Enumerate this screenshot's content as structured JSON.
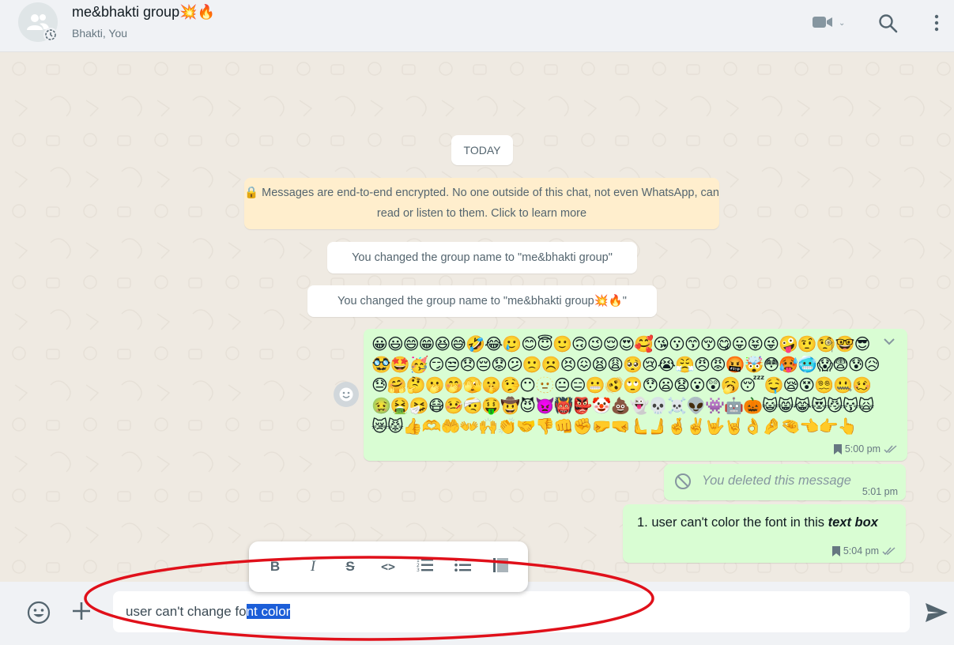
{
  "header": {
    "title": "me&bhakti group💥🔥",
    "subtitle": "Bhakti, You",
    "icons": [
      "group-avatar-icon",
      "video-call-icon",
      "chevron-down-icon",
      "search-icon",
      "menu-icon"
    ]
  },
  "chat": {
    "date_label": "TODAY",
    "encryption_notice": "🔒 Messages are end-to-end encrypted. No one outside of this chat, not even WhatsApp, can read or listen to them. Click to learn more",
    "system_messages": [
      "You changed the group name to \"me&bhakti group\"",
      "You changed the group name to \"me&bhakti group💥🔥\""
    ],
    "messages": [
      {
        "type": "emoji",
        "text": "😀😃😄😁😆😅🤣😂🥲😊😇🙂🙃😉😌😍🥰😘😗😙😚😋😛😝😜🤪🤨🧐🤓😎🥸🤩🥳😏😒😞😔😟😕🙁☹️😣😖😫😩🥺😢😭😤😠😡🤬🤯😳🥵🥶😱😨😰😥😓🤗🤔🫢🤭🫣🤫🤥😶🫥😐😑😬🫨🙄😯😦😧😮😲🥱😴🤤😪😵😵‍💫🤐🥴🤢🤮🤧😷🤒🤕🤑🤠😈👿👹👺🤡💩👻💀☠️👽👾🤖🎃😺😸😹😻😼😽🙀😿😾👍🫶🤲👐🙌👏🤝👎👊✊🤛🤜🫷🫸🤞✌️🤟🤘👌🤌🤏👈👉👆",
        "time": "5:00 pm"
      },
      {
        "type": "deleted",
        "text": "You deleted this message",
        "time": "5:01 pm"
      },
      {
        "type": "text",
        "list_number": "1.",
        "text_plain": "user can't color the font in this ",
        "text_bold": "text box",
        "time": "5:04 pm"
      }
    ]
  },
  "format_toolbar": {
    "bold": "B",
    "italic": "I",
    "strike": "S",
    "code": "<>",
    "ordered_list": "ordered-list-icon",
    "bullet_list": "bullet-list-icon",
    "quote": "quote-icon"
  },
  "composer": {
    "text_before_selection": "user can't change fo",
    "selected_text": "nt color",
    "icons": [
      "emoji-icon",
      "plus-icon",
      "send-icon"
    ]
  },
  "colors": {
    "outgoing_bubble": "#d9fdd3",
    "chat_background": "#efeae2",
    "encryption_banner": "#ffeecd",
    "selection": "#1c5ed8",
    "annotation": "#e0101a"
  }
}
